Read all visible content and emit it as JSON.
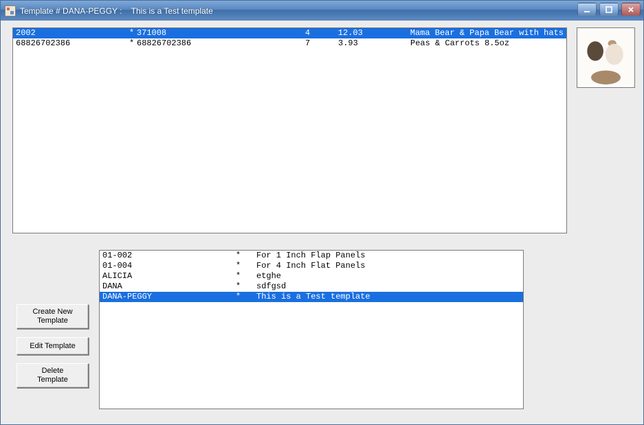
{
  "window": {
    "title": "Template # DANA-PEGGY :    This is a Test template"
  },
  "top_rows": [
    {
      "selected": true,
      "code": "2002",
      "mark": "*",
      "ref": "371008",
      "qty": "4",
      "price": "12.03",
      "desc": "Mama Bear & Papa Bear with hats"
    },
    {
      "selected": false,
      "code": "68826702386",
      "mark": "*",
      "ref": "68826702386",
      "qty": "7",
      "price": "3.93",
      "desc": "Peas & Carrots 8.5oz"
    }
  ],
  "template_rows": [
    {
      "selected": false,
      "name": "01-002",
      "mark": "*",
      "desc": "For 1 Inch Flap Panels"
    },
    {
      "selected": false,
      "name": "01-004",
      "mark": "*",
      "desc": "For 4 Inch Flat Panels"
    },
    {
      "selected": false,
      "name": "ALICIA",
      "mark": "*",
      "desc": "etghe"
    },
    {
      "selected": false,
      "name": "DANA",
      "mark": "*",
      "desc": "sdfgsd"
    },
    {
      "selected": true,
      "name": "DANA-PEGGY",
      "mark": "*",
      "desc": "This is a Test template"
    }
  ],
  "buttons": {
    "create": "Create New\nTemplate",
    "edit": "Edit Template",
    "delete": "Delete\nTemplate"
  }
}
